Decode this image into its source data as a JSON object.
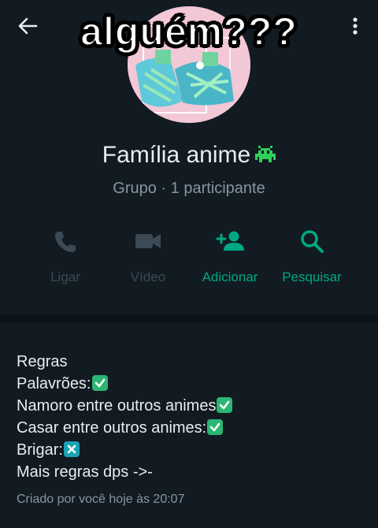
{
  "caption": "alguém???",
  "header": {
    "back_icon": "arrow-back-icon",
    "menu_icon": "more-vertical-icon"
  },
  "group": {
    "name": "Família anime",
    "name_emoji": "alien-monster-icon",
    "subtitle": "Grupo · 1 participante"
  },
  "actions": [
    {
      "label": "Ligar",
      "icon": "phone-icon",
      "enabled": false
    },
    {
      "label": "Vídeo",
      "icon": "video-icon",
      "enabled": false
    },
    {
      "label": "Adicionar",
      "icon": "add-person-icon",
      "enabled": true
    },
    {
      "label": "Pesquisar",
      "icon": "search-icon",
      "enabled": true
    }
  ],
  "description": {
    "lines": [
      {
        "text": "Regras",
        "emoji": ""
      },
      {
        "text": "Palavrões:",
        "emoji": "check-mark-icon"
      },
      {
        "text": "Namoro entre outros animes",
        "emoji": "check-mark-icon"
      },
      {
        "text": "Casar entre outros animes:",
        "emoji": "check-mark-icon"
      },
      {
        "text": "Brigar:",
        "emoji": "cross-mark-icon"
      },
      {
        "text": "Mais regras dps ->-",
        "emoji": ""
      }
    ],
    "created": "Criado por você hoje às 20:07"
  },
  "colors": {
    "background": "#111b21",
    "divider": "#0b141a",
    "accent": "#00a884",
    "muted_text": "#8696a0",
    "disabled": "#3b4a54"
  }
}
